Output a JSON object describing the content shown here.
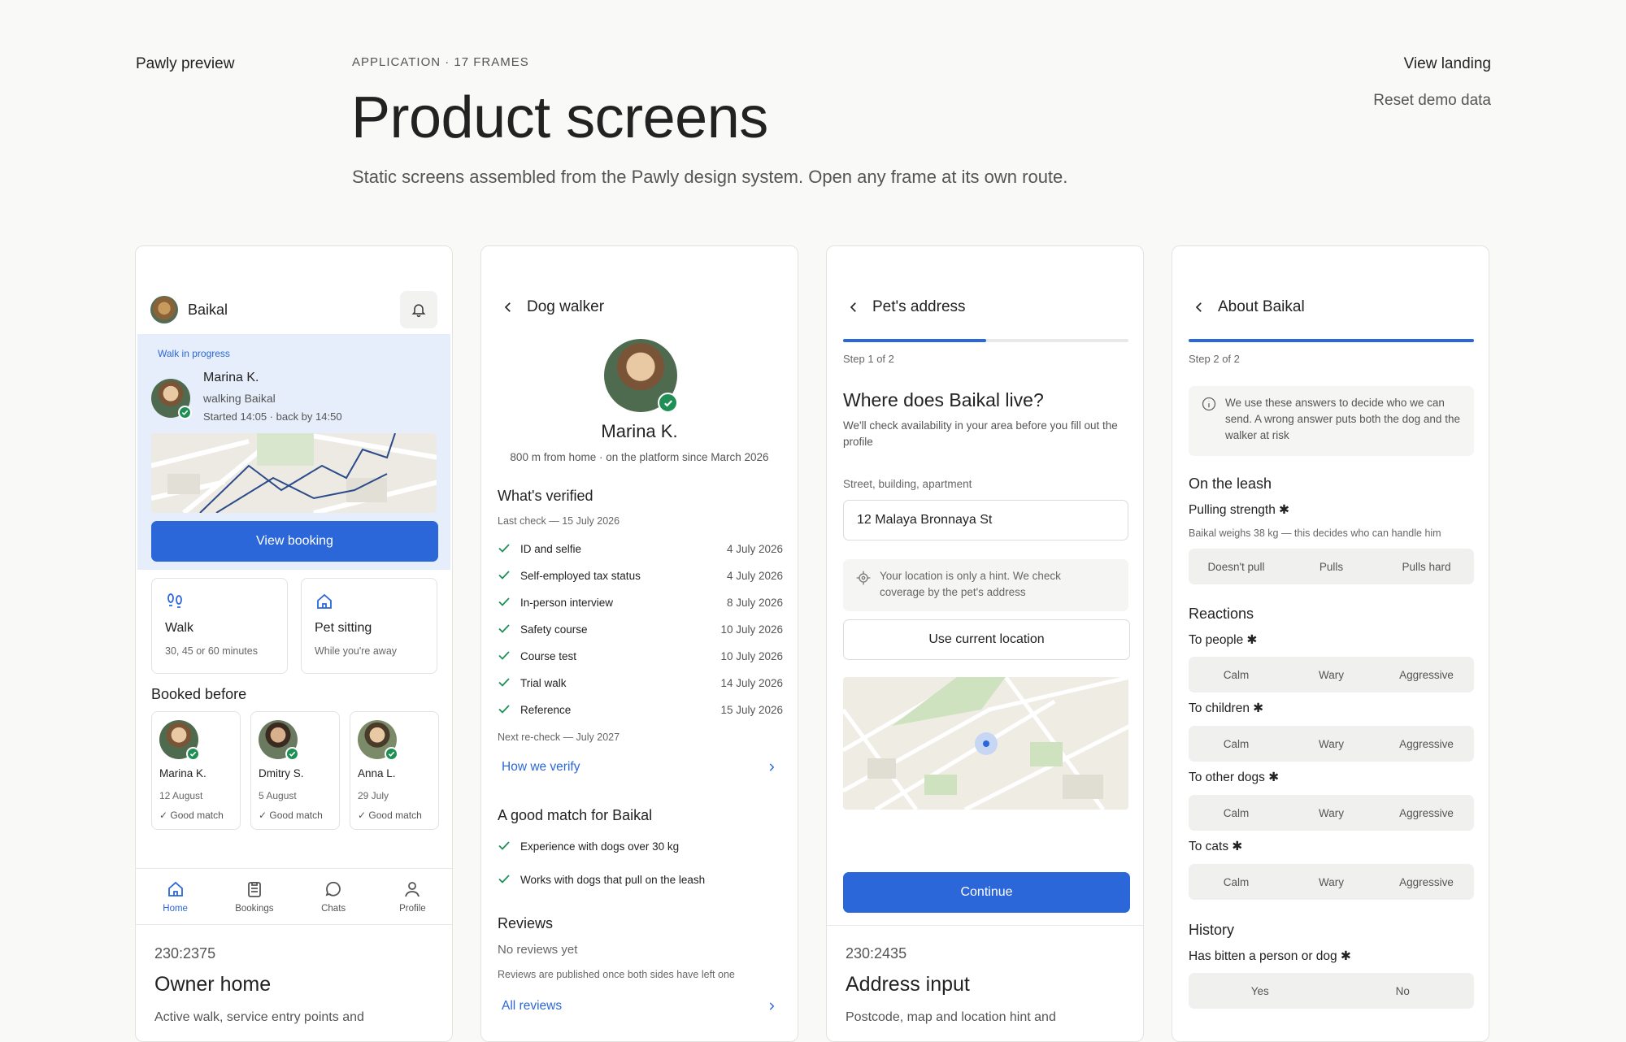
{
  "header": {
    "brand": "Pawly preview",
    "eyebrow": "APPLICATION · 17 FRAMES",
    "title": "Product screens",
    "subtitle": "Static screens assembled from the Pawly design system. Open any frame at its own route.",
    "view_landing": "View landing",
    "reset_demo": "Reset demo data"
  },
  "owner_home": {
    "pet_name": "Baikal",
    "walk_status": "Walk in progress",
    "walker_name": "Marina K.",
    "walker_activity": "walking Baikal",
    "walk_time": "Started 14:05 · back by 14:50",
    "view_booking": "View booking",
    "services": [
      {
        "title": "Walk",
        "subtitle": "30, 45 or 60 minutes",
        "icon": "paw-prints-icon"
      },
      {
        "title": "Pet sitting",
        "subtitle": "While you're away",
        "icon": "home-icon"
      }
    ],
    "booked_before_title": "Booked before",
    "booked_before": [
      {
        "name": "Marina K.",
        "date": "12 August",
        "match": "Good match"
      },
      {
        "name": "Dmitry S.",
        "date": "5 August",
        "match": "Good match"
      },
      {
        "name": "Anna L.",
        "date": "29 July",
        "match": "Good match"
      }
    ],
    "tabs": [
      {
        "label": "Home",
        "icon": "home-icon",
        "active": true
      },
      {
        "label": "Bookings",
        "icon": "clipboard-icon",
        "active": false
      },
      {
        "label": "Chats",
        "icon": "chat-bubble-icon",
        "active": false
      },
      {
        "label": "Profile",
        "icon": "user-icon",
        "active": false
      }
    ],
    "frame_id": "230:2375",
    "frame_name": "Owner home",
    "frame_desc": "Active walk, service entry points and"
  },
  "dog_walker": {
    "header_title": "Dog walker",
    "name": "Marina K.",
    "meta": "800 m from home · on the platform since March 2026",
    "verified_title": "What's verified",
    "last_check": "Last check — 15 July 2026",
    "checks": [
      {
        "label": "ID and selfie",
        "date": "4 July 2026"
      },
      {
        "label": "Self-employed tax status",
        "date": "4 July 2026"
      },
      {
        "label": "In-person interview",
        "date": "8 July 2026"
      },
      {
        "label": "Safety course",
        "date": "10 July 2026"
      },
      {
        "label": "Course test",
        "date": "10 July 2026"
      },
      {
        "label": "Trial walk",
        "date": "14 July 2026"
      },
      {
        "label": "Reference",
        "date": "15 July 2026"
      }
    ],
    "next_recheck": "Next re-check — July 2027",
    "how_we_verify": "How we verify",
    "match_title": "A good match for Baikal",
    "matches": [
      "Experience with dogs over 30 kg",
      "Works with dogs that pull on the leash"
    ],
    "reviews_title": "Reviews",
    "no_reviews": "No reviews yet",
    "reviews_note": "Reviews are published once both sides have left one",
    "all_reviews": "All reviews"
  },
  "address": {
    "header_title": "Pet's address",
    "progress": 0.5,
    "step": "Step 1 of 2",
    "question": "Where does Baikal live?",
    "description": "We'll check availability in your area before you fill out the profile",
    "field_label": "Street, building, apartment",
    "field_value": "12 Malaya Bronnaya St",
    "hint": "Your location is only a hint. We check coverage by the pet's address",
    "use_location": "Use current location",
    "continue": "Continue",
    "frame_id": "230:2435",
    "frame_name": "Address input",
    "frame_desc": "Postcode, map and location hint and"
  },
  "about": {
    "header_title": "About Baikal",
    "progress": 1.0,
    "step": "Step 2 of 2",
    "info": "We use these answers to decide who we can send. A wrong answer puts both the dog and the walker at risk",
    "leash_title": "On the leash",
    "pulling_label": "Pulling strength ✱",
    "pulling_note": "Baikal weighs 38 kg — this decides who can handle him",
    "pulling_options": [
      "Doesn't pull",
      "Pulls",
      "Pulls hard"
    ],
    "reactions_title": "Reactions",
    "reactions": [
      {
        "label": "To people ✱",
        "options": [
          "Calm",
          "Wary",
          "Aggressive"
        ]
      },
      {
        "label": "To children ✱",
        "options": [
          "Calm",
          "Wary",
          "Aggressive"
        ]
      },
      {
        "label": "To other dogs ✱",
        "options": [
          "Calm",
          "Wary",
          "Aggressive"
        ]
      },
      {
        "label": "To cats ✱",
        "options": [
          "Calm",
          "Wary",
          "Aggressive"
        ]
      }
    ],
    "history_title": "History",
    "bitten_label": "Has bitten a person or dog ✱",
    "bitten_options": [
      "Yes",
      "No"
    ]
  },
  "colors": {
    "accent": "#2b67d9",
    "verified": "#1f8f55",
    "walk_bg": "#e6eefb"
  }
}
